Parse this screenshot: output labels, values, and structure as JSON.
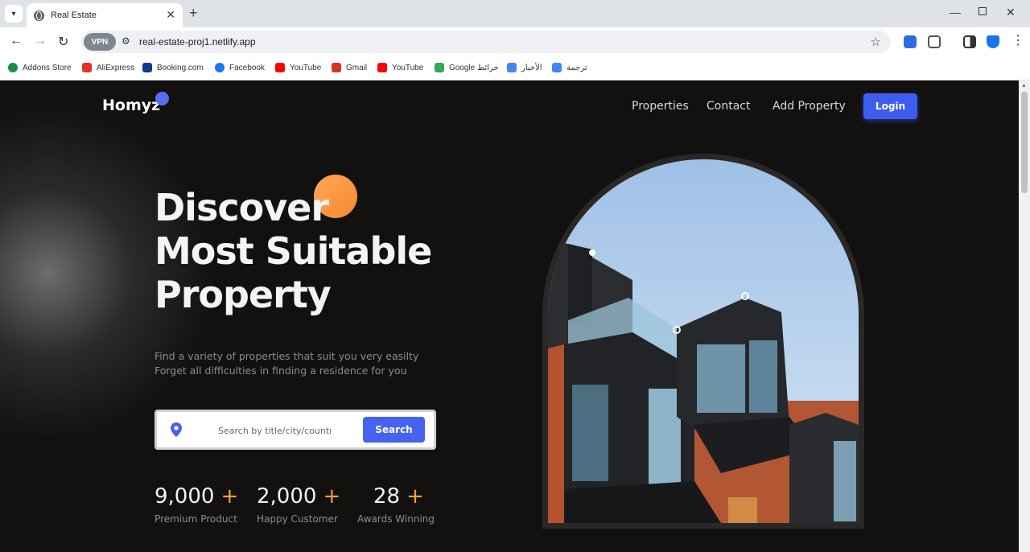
{
  "browser": {
    "tab_title": "Real Estate",
    "url": "real-estate-proj1.netlify.app",
    "vpn_label": "VPN",
    "bookmarks": [
      {
        "label": "Addons Store",
        "color": "#1b8f4a"
      },
      {
        "label": "AliExpress",
        "color": "#e43225"
      },
      {
        "label": "Booking.com",
        "color": "#0c3b8e"
      },
      {
        "label": "Facebook",
        "color": "#1877f2"
      },
      {
        "label": "YouTube",
        "color": "#ff0000"
      },
      {
        "label": "Gmail",
        "color": "#d93025"
      },
      {
        "label": "YouTube",
        "color": "#ff0000"
      },
      {
        "label": "Google خرائط",
        "color": "#34a853"
      },
      {
        "label": "الأخبار",
        "color": "#4285f4"
      },
      {
        "label": "ترجمة",
        "color": "#4285f4"
      }
    ]
  },
  "site": {
    "logo": "Homyz",
    "nav": {
      "properties": "Properties",
      "contact": "Contact",
      "add_property": "Add Property",
      "login": "Login"
    },
    "hero": {
      "title_lines": [
        "Discover",
        "Most Suitable",
        "Property"
      ],
      "subtitle_lines": [
        "Find a variety of properties that suit you very easilty",
        "Forget all difficulties in finding a residence for you"
      ]
    },
    "search": {
      "placeholder": "Search by title/city/country",
      "button": "Search"
    },
    "stats": [
      {
        "value": "9,000",
        "plus": "+",
        "label": "Premium Product"
      },
      {
        "value": "2,000",
        "plus": "+",
        "label": "Happy Customer"
      },
      {
        "value": "28",
        "plus": "+",
        "label": "Awards Winning"
      }
    ]
  },
  "colors": {
    "accent_blue": "#3e5cf0",
    "accent_orange": "#f6a23a",
    "page_bg": "#131110"
  }
}
